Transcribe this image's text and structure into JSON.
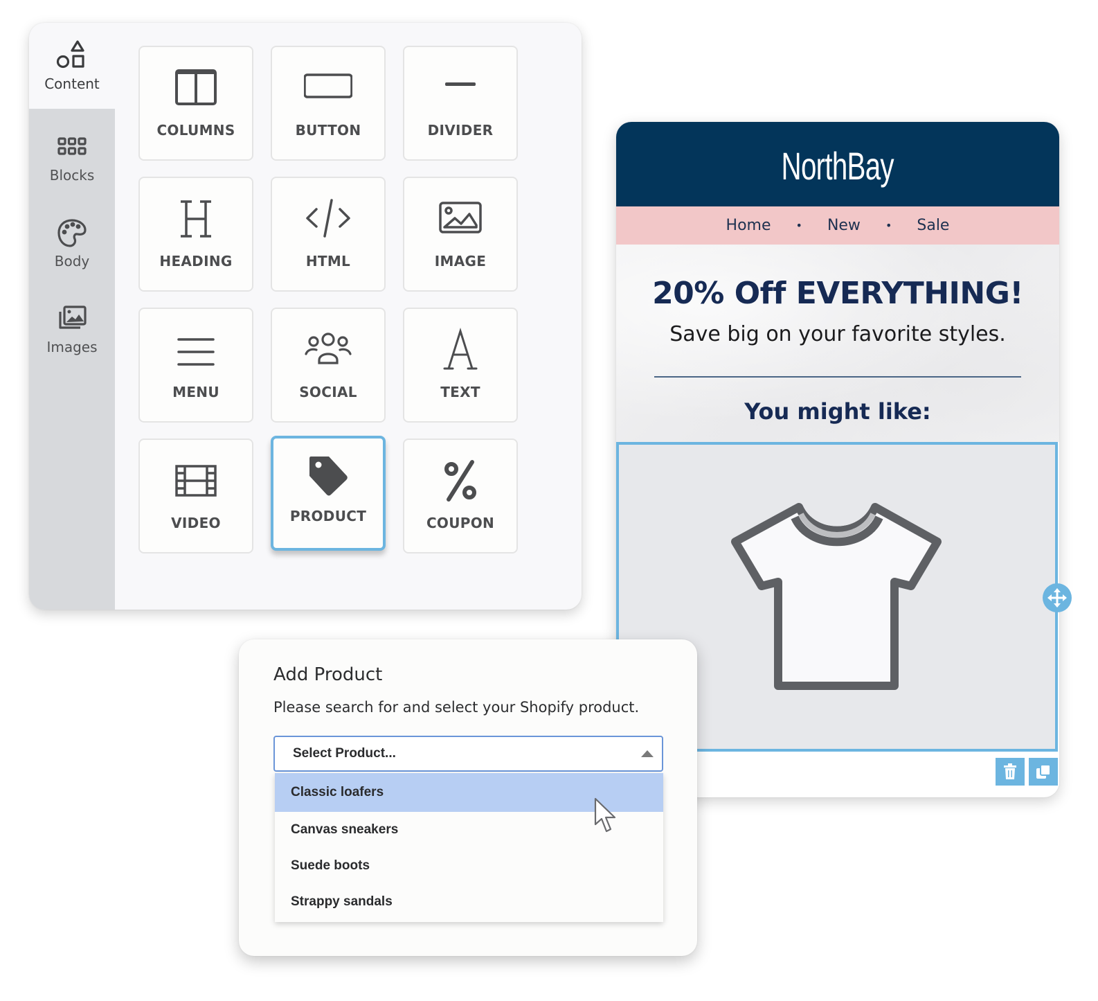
{
  "builder": {
    "sidebar": [
      {
        "label": "Content",
        "icon": "shapes-icon",
        "active": true
      },
      {
        "label": "Blocks",
        "icon": "grid-icon",
        "active": false
      },
      {
        "label": "Body",
        "icon": "palette-icon",
        "active": false
      },
      {
        "label": "Images",
        "icon": "images-icon",
        "active": false
      }
    ],
    "tiles": [
      {
        "label": "COLUMNS",
        "icon": "columns-icon"
      },
      {
        "label": "BUTTON",
        "icon": "button-icon"
      },
      {
        "label": "DIVIDER",
        "icon": "divider-icon"
      },
      {
        "label": "HEADING",
        "icon": "heading-icon"
      },
      {
        "label": "HTML",
        "icon": "code-icon"
      },
      {
        "label": "IMAGE",
        "icon": "image-icon"
      },
      {
        "label": "MENU",
        "icon": "menu-icon"
      },
      {
        "label": "SOCIAL",
        "icon": "people-icon"
      },
      {
        "label": "TEXT",
        "icon": "text-icon"
      },
      {
        "label": "VIDEO",
        "icon": "film-icon"
      },
      {
        "label": "PRODUCT",
        "icon": "tag-icon",
        "selected": true
      },
      {
        "label": "COUPON",
        "icon": "percent-icon"
      }
    ]
  },
  "email": {
    "brand": "NorthBay",
    "nav": [
      "Home",
      "New",
      "Sale"
    ],
    "nav_separator": "•",
    "headline": "20% Off EVERYTHING!",
    "subheadline": "Save big on  your favorite styles.",
    "section_title": "You might like:",
    "product_image": "tshirt-icon",
    "colors": {
      "header": "#03355a",
      "nav": "#f2c7c8",
      "accent": "#6cb5e0",
      "headline": "#162a54"
    }
  },
  "modal": {
    "title": "Add Product",
    "description": "Please search for and select your Shopify product.",
    "select_placeholder": "Select Product...",
    "options": [
      "Classic loafers",
      "Canvas sneakers",
      "Suede boots",
      "Strappy sandals"
    ],
    "hovered_option": "Classic loafers"
  }
}
